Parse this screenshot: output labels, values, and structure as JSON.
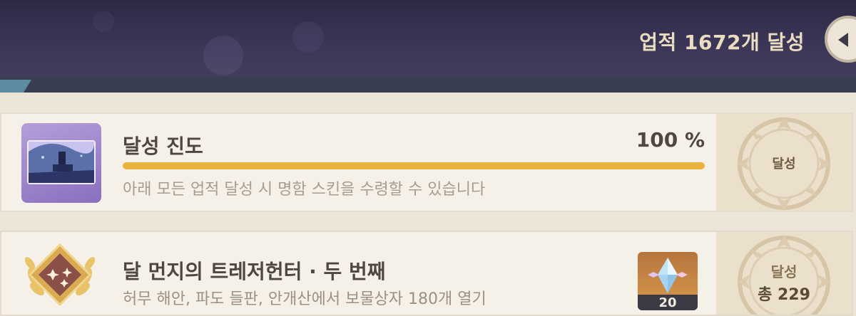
{
  "header": {
    "achievements_count": "업적 1672개 달성",
    "back_button": "back"
  },
  "progress_card": {
    "title": "달성 진도",
    "percent_text": "100 %",
    "progress": 1.0,
    "description": "아래 모든 업적 달성 시 명함 스킨을 수령할 수 있습니다",
    "status": "달성",
    "accent": "#eab43c"
  },
  "achievement_card": {
    "title": "달 먼지의 트레저헌터 · 두 번째",
    "description": "허무 해안, 파도 들판, 안개산에서 보물상자 180개 열기",
    "reward_icon": "primogem-icon",
    "reward_count": "20",
    "status": "달성",
    "total": "총 229"
  }
}
